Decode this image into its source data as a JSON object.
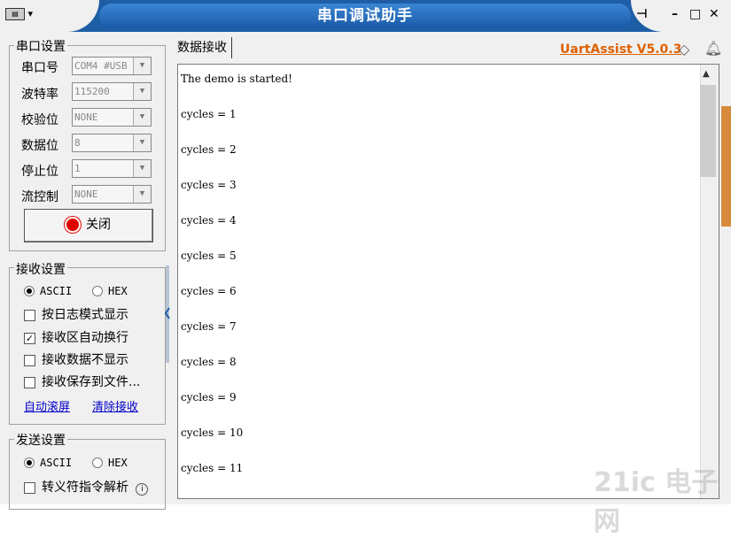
{
  "window": {
    "title": "串口调试助手",
    "brand": "UartAssist V5.0.3"
  },
  "serial_settings": {
    "title": "串口设置",
    "rows": [
      {
        "label": "串口号",
        "value": "COM4 #USB"
      },
      {
        "label": "波特率",
        "value": "115200"
      },
      {
        "label": "校验位",
        "value": "NONE"
      },
      {
        "label": "数据位",
        "value": "8"
      },
      {
        "label": "停止位",
        "value": "1"
      },
      {
        "label": "流控制",
        "value": "NONE"
      }
    ],
    "close_button": "关闭"
  },
  "receive_settings": {
    "title": "接收设置",
    "ascii": "ASCII",
    "hex": "HEX",
    "options": [
      "按日志模式显示",
      "接收区自动换行",
      "接收数据不显示",
      "接收保存到文件..."
    ],
    "checked": [
      false,
      true,
      false,
      false
    ],
    "auto_scroll": "自动滚屏",
    "clear": "清除接收"
  },
  "send_settings": {
    "title": "发送设置",
    "ascii": "ASCII",
    "hex": "HEX",
    "escape_option": "转义符指令解析"
  },
  "receive_tab": "数据接收",
  "received_text": "The demo is started!\n\ncycles = 1\n\ncycles = 2\n\ncycles = 3\n\ncycles = 4\n\ncycles = 5\n\ncycles = 6\n\ncycles = 7\n\ncycles = 8\n\ncycles = 9\n\ncycles = 10\n\ncycles = 11",
  "watermark": "21ic 电子网"
}
